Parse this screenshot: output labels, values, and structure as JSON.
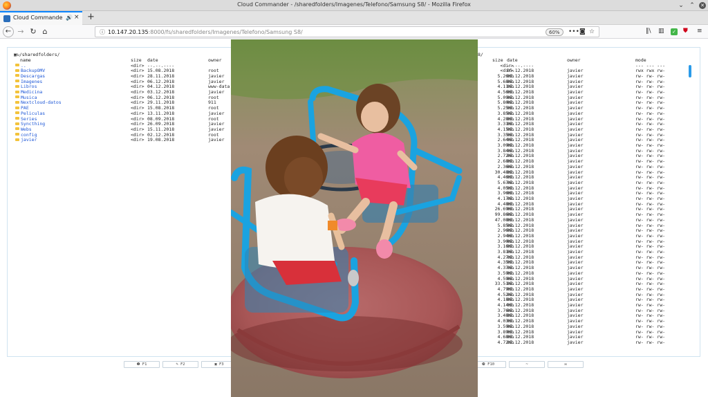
{
  "window": {
    "title": "Cloud Commander - /sharedfolders/Imagenes/Telefono/Samsung S8/ - Mozilla Firefox"
  },
  "tab": {
    "title": "Cloud Commander - /sh",
    "close": "×"
  },
  "newtab": "+",
  "nav": {
    "back": "←",
    "forward": "→",
    "reload": "↻",
    "home": "⌂",
    "url_host": "10.147.20.135",
    "url_rest": ":8000/fs/sharedfolders/Imagenes/Telefono/Samsung S8/",
    "zoom": "60%"
  },
  "left_panel": {
    "path": "/sharedfolders/",
    "headers": {
      "name": "name",
      "size": "size",
      "date": "date",
      "owner": "owner"
    },
    "rows": [
      {
        "name": "..",
        "size": "<dir>",
        "date": "--.--.----",
        "owner": ""
      },
      {
        "name": "BackupOMV",
        "size": "<dir>",
        "date": "15.08.2018",
        "owner": "root"
      },
      {
        "name": "Descargas",
        "size": "<dir>",
        "date": "28.11.2018",
        "owner": "javier"
      },
      {
        "name": "Imagenes",
        "size": "<dir>",
        "date": "06.12.2018",
        "owner": "javier"
      },
      {
        "name": "Libros",
        "size": "<dir>",
        "date": "04.12.2018",
        "owner": "www-data"
      },
      {
        "name": "Medicina",
        "size": "<dir>",
        "date": "03.12.2018",
        "owner": "javier"
      },
      {
        "name": "Musica",
        "size": "<dir>",
        "date": "06.12.2018",
        "owner": "root"
      },
      {
        "name": "Nextcloud-datos",
        "size": "<dir>",
        "date": "29.11.2018",
        "owner": "911"
      },
      {
        "name": "PAE",
        "size": "<dir>",
        "date": "15.08.2018",
        "owner": "root"
      },
      {
        "name": "Peliculas",
        "size": "<dir>",
        "date": "13.11.2018",
        "owner": "javier"
      },
      {
        "name": "Series",
        "size": "<dir>",
        "date": "08.09.2018",
        "owner": "root"
      },
      {
        "name": "Syncthing",
        "size": "<dir>",
        "date": "26.09.2018",
        "owner": "javier"
      },
      {
        "name": "Webs",
        "size": "<dir>",
        "date": "15.11.2018",
        "owner": "javier"
      },
      {
        "name": "config",
        "size": "<dir>",
        "date": "02.12.2018",
        "owner": "root"
      },
      {
        "name": "javier",
        "size": "<dir>",
        "date": "19.08.2018",
        "owner": "javier"
      }
    ]
  },
  "right_panel": {
    "path_tail": "8/",
    "headers": {
      "size": "size",
      "date": "date",
      "owner": "owner",
      "mode": "mode"
    },
    "rows": [
      {
        "size": "<dir>",
        "date": "--.--.----",
        "owner": "",
        "mode": "--- --- ---"
      },
      {
        "size": "<dir>",
        "date": "05.12.2018",
        "owner": "javier",
        "mode": "rwx rwx rw-"
      },
      {
        "size": "5.26mb",
        "date": "05.12.2018",
        "owner": "javier",
        "mode": "rw- rw- rw-"
      },
      {
        "size": "5.68mb",
        "date": "05.12.2018",
        "owner": "javier",
        "mode": "rw- rw- rw-"
      },
      {
        "size": "4.11mb",
        "date": "05.12.2018",
        "owner": "javier",
        "mode": "rw- rw- rw-"
      },
      {
        "size": "4.56mb",
        "date": "05.12.2018",
        "owner": "javier",
        "mode": "rw- rw- rw-"
      },
      {
        "size": "5.09mb",
        "date": "05.12.2018",
        "owner": "javier",
        "mode": "rw- rw- rw-"
      },
      {
        "size": "5.80mb",
        "date": "05.12.2018",
        "owner": "javier",
        "mode": "rw- rw- rw-"
      },
      {
        "size": "5.25mb",
        "date": "05.12.2018",
        "owner": "javier",
        "mode": "rw- rw- rw-"
      },
      {
        "size": "3.85mb",
        "date": "05.12.2018",
        "owner": "javier",
        "mode": "rw- rw- rw-"
      },
      {
        "size": "4.28mb",
        "date": "05.12.2018",
        "owner": "javier",
        "mode": "rw- rw- rw-"
      },
      {
        "size": "3.31mb",
        "date": "05.12.2018",
        "owner": "javier",
        "mode": "rw- rw- rw-"
      },
      {
        "size": "4.15mb",
        "date": "05.12.2018",
        "owner": "javier",
        "mode": "rw- rw- rw-"
      },
      {
        "size": "3.35mb",
        "date": "05.12.2018",
        "owner": "javier",
        "mode": "rw- rw- rw-"
      },
      {
        "size": "2.64mb",
        "date": "05.12.2018",
        "owner": "javier",
        "mode": "rw- rw- rw-"
      },
      {
        "size": "3.09mb",
        "date": "05.12.2018",
        "owner": "javier",
        "mode": "rw- rw- rw-"
      },
      {
        "size": "3.84mb",
        "date": "05.12.2018",
        "owner": "javier",
        "mode": "rw- rw- rw-"
      },
      {
        "size": "2.72mb",
        "date": "05.12.2018",
        "owner": "javier",
        "mode": "rw- rw- rw-"
      },
      {
        "size": "2.68mb",
        "date": "05.12.2018",
        "owner": "javier",
        "mode": "rw- rw- rw-"
      },
      {
        "size": "2.36mb",
        "date": "05.12.2018",
        "owner": "javier",
        "mode": "rw- rw- rw-"
      },
      {
        "size": "30.48mb",
        "date": "05.12.2018",
        "owner": "javier",
        "mode": "rw- rw- rw-"
      },
      {
        "size": "4.46mb",
        "date": "05.12.2018",
        "owner": "javier",
        "mode": "rw- rw- rw-"
      },
      {
        "size": "5.67mb",
        "date": "05.12.2018",
        "owner": "javier",
        "mode": "rw- rw- rw-"
      },
      {
        "size": "4.05mb",
        "date": "05.12.2018",
        "owner": "javier",
        "mode": "rw- rw- rw-"
      },
      {
        "size": "3.96mb",
        "date": "05.12.2018",
        "owner": "javier",
        "mode": "rw- rw- rw-"
      },
      {
        "size": "4.17mb",
        "date": "05.12.2018",
        "owner": "javier",
        "mode": "rw- rw- rw-"
      },
      {
        "size": "4.48mb",
        "date": "05.12.2018",
        "owner": "javier",
        "mode": "rw- rw- rw-"
      },
      {
        "size": "26.69mb",
        "date": "05.12.2018",
        "owner": "javier",
        "mode": "rw- rw- rw-"
      },
      {
        "size": "99.86mb",
        "date": "05.12.2018",
        "owner": "javier",
        "mode": "rw- rw- rw-"
      },
      {
        "size": "47.08mb",
        "date": "05.12.2018",
        "owner": "javier",
        "mode": "rw- rw- rw-"
      },
      {
        "size": "5.85mb",
        "date": "05.12.2018",
        "owner": "javier",
        "mode": "rw- rw- rw-"
      },
      {
        "size": "2.96mb",
        "date": "05.12.2018",
        "owner": "javier",
        "mode": "rw- rw- rw-"
      },
      {
        "size": "2.94mb",
        "date": "05.12.2018",
        "owner": "javier",
        "mode": "rw- rw- rw-"
      },
      {
        "size": "3.90mb",
        "date": "05.12.2018",
        "owner": "javier",
        "mode": "rw- rw- rw-"
      },
      {
        "size": "3.16mb",
        "date": "05.12.2018",
        "owner": "javier",
        "mode": "rw- rw- rw-"
      },
      {
        "size": "3.81mb",
        "date": "05.12.2018",
        "owner": "javier",
        "mode": "rw- rw- rw-"
      },
      {
        "size": "4.27mb",
        "date": "05.12.2018",
        "owner": "javier",
        "mode": "rw- rw- rw-"
      },
      {
        "size": "4.35mb",
        "date": "05.12.2018",
        "owner": "javier",
        "mode": "rw- rw- rw-"
      },
      {
        "size": "4.37mb",
        "date": "05.12.2018",
        "owner": "javier",
        "mode": "rw- rw- rw-"
      },
      {
        "size": "3.59mb",
        "date": "05.12.2018",
        "owner": "javier",
        "mode": "rw- rw- rw-"
      },
      {
        "size": "4.59mb",
        "date": "05.12.2018",
        "owner": "javier",
        "mode": "rw- rw- rw-"
      },
      {
        "size": "33.51mb",
        "date": "05.12.2018",
        "owner": "javier",
        "mode": "rw- rw- rw-"
      },
      {
        "size": "4.79mb",
        "date": "05.12.2018",
        "owner": "javier",
        "mode": "rw- rw- rw-"
      },
      {
        "size": "4.52mb",
        "date": "05.12.2018",
        "owner": "javier",
        "mode": "rw- rw- rw-"
      },
      {
        "size": "4.18mb",
        "date": "05.12.2018",
        "owner": "javier",
        "mode": "rw- rw- rw-"
      },
      {
        "size": "4.14mb",
        "date": "05.12.2018",
        "owner": "javier",
        "mode": "rw- rw- rw-"
      },
      {
        "size": "3.76mb",
        "date": "05.12.2018",
        "owner": "javier",
        "mode": "rw- rw- rw-"
      },
      {
        "size": "3.48mb",
        "date": "05.12.2018",
        "owner": "javier",
        "mode": "rw- rw- rw-"
      },
      {
        "size": "4.03mb",
        "date": "05.12.2018",
        "owner": "javier",
        "mode": "rw- rw- rw-"
      },
      {
        "size": "3.59mb",
        "date": "05.12.2018",
        "owner": "javier",
        "mode": "rw- rw- rw-"
      },
      {
        "size": "3.89mb",
        "date": "05.12.2018",
        "owner": "javier",
        "mode": "rw- rw- rw-"
      },
      {
        "size": "4.68mb",
        "date": "05.12.2018",
        "owner": "javier",
        "mode": "rw- rw- rw-"
      },
      {
        "size": "4.72mb",
        "date": "05.12.2018",
        "owner": "javier",
        "mode": "rw- rw- rw-"
      }
    ]
  },
  "fkeys": [
    {
      "label": "❶ F1"
    },
    {
      "label": "✎ F2"
    },
    {
      "label": "▣ F3"
    },
    {
      "label": "❿ F10"
    },
    {
      "label": "~"
    },
    {
      "label": "✉"
    }
  ],
  "colors": {
    "link": "#1a55d6",
    "accent": "#2b9be9",
    "folder": "#f3c33c"
  }
}
